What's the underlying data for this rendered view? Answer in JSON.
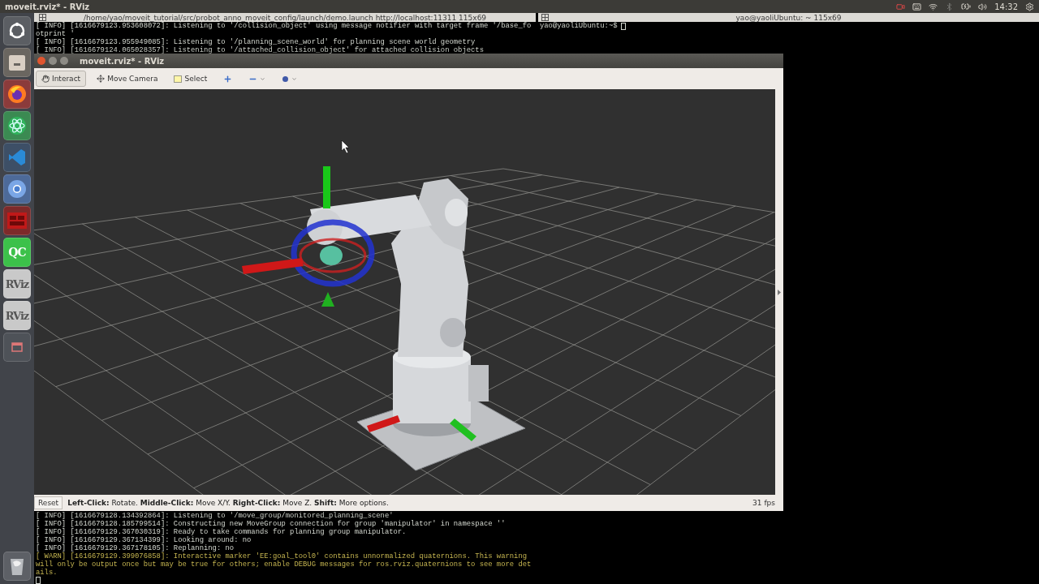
{
  "top_panel": {
    "title": "moveit.rviz* - RViz",
    "clock": "14:32"
  },
  "launcher": {
    "items": [
      {
        "kind": "ubuntu"
      },
      {
        "kind": "files"
      },
      {
        "kind": "firefox"
      },
      {
        "kind": "atom"
      },
      {
        "kind": "vscode"
      },
      {
        "kind": "chromium"
      },
      {
        "kind": "red-app"
      },
      {
        "kind": "text-app",
        "label": "QC",
        "color": "#3cc14a"
      },
      {
        "kind": "text-app",
        "label": "RViz",
        "color": "#c9c9c9"
      },
      {
        "kind": "text-app",
        "label": "RViz",
        "color": "#c9c9c9"
      },
      {
        "kind": "window"
      }
    ],
    "trash": {
      "kind": "trash"
    }
  },
  "terminals": [
    {
      "title": "/home/yao/moveit_tutorial/src/probot_anno_moveit_config/launch/demo.launch http://localhost:11311 115x69",
      "lines_top": [
        {
          "kind": "info",
          "text": "[ INFO] [1616679123.953608072]: Listening to '/collision_object' using message notifier with target frame '/base_fo"
        },
        {
          "kind": "info",
          "text": "otprint '"
        },
        {
          "kind": "info",
          "text": "[ INFO] [1616679123.955949085]: Listening to '/planning_scene_world' for planning scene world geometry"
        },
        {
          "kind": "info",
          "text": "[ INFO] [1616679124.065028357]: Listening to '/attached_collision_object' for attached collision objects"
        }
      ],
      "lines_bottom": [
        {
          "kind": "info",
          "text": "[ INFO] [1616679128.134392864]: Listening to '/move_group/monitored_planning_scene'"
        },
        {
          "kind": "info",
          "text": "[ INFO] [1616679128.185799514]: Constructing new MoveGroup connection for group 'manipulator' in namespace ''"
        },
        {
          "kind": "info",
          "text": "[ INFO] [1616679129.367030319]: Ready to take commands for planning group manipulator."
        },
        {
          "kind": "info",
          "text": "[ INFO] [1616679129.367134399]: Looking around: no"
        },
        {
          "kind": "info",
          "text": "[ INFO] [1616679129.367178105]: Replanning: no"
        },
        {
          "kind": "warn",
          "text": "[ WARN] [1616679129.399076858]: Interactive marker 'EE:goal_tool0' contains unnormalized quaternions. This warning"
        },
        {
          "kind": "warn",
          "text": "will only be output once but may be true for others; enable DEBUG messages for ros.rviz.quaternions to see more det"
        },
        {
          "kind": "warn",
          "text": "ails."
        }
      ]
    },
    {
      "title": "yao@yaoliUbuntu: ~ 115x69",
      "prompt": "yao@yaoliUbuntu:~$"
    }
  ],
  "rviz": {
    "title": "moveit.rviz* - RViz",
    "tools": [
      {
        "kind": "interact",
        "label": "Interact",
        "selected": true
      },
      {
        "kind": "move-camera",
        "label": "Move Camera",
        "selected": false
      },
      {
        "kind": "select",
        "label": "Select",
        "selected": false
      },
      {
        "kind": "add",
        "selected": false
      },
      {
        "kind": "remove",
        "selected": false
      },
      {
        "kind": "point",
        "selected": false
      }
    ],
    "status": {
      "reset": "Reset",
      "hint": "**Left-Click:** Rotate. **Middle-Click:** Move X/Y. **Right-Click:** Move Z. **Shift:** More options.",
      "fps": "31 fps"
    }
  }
}
